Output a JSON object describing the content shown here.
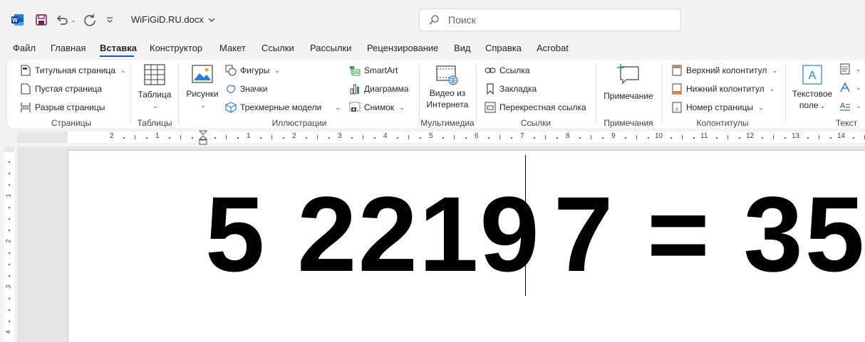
{
  "titlebar": {
    "doc_title": "WiFiGiD.RU.docx",
    "search_placeholder": "Поиск"
  },
  "tabs": [
    "Файл",
    "Главная",
    "Вставка",
    "Конструктор",
    "Макет",
    "Ссылки",
    "Рассылки",
    "Рецензирование",
    "Вид",
    "Справка",
    "Acrobat"
  ],
  "active_tab": "Вставка",
  "ribbon": {
    "pages": {
      "label": "Страницы",
      "cover": "Титульная страница",
      "blank": "Пустая страница",
      "break": "Разрыв страницы"
    },
    "tables": {
      "label": "Таблицы",
      "table": "Таблица"
    },
    "illustrations": {
      "label": "Иллюстрации",
      "pictures": "Рисунки",
      "shapes": "Фигуры",
      "icons": "Значки",
      "models3d": "Трехмерные модели",
      "smartart": "SmartArt",
      "chart": "Диаграмма",
      "screenshot": "Снимок"
    },
    "media": {
      "label": "Мультимедиа",
      "video_line1": "Видео из",
      "video_line2": "Интернета"
    },
    "links": {
      "label": "Ссылки",
      "link": "Ссылка",
      "bookmark": "Закладка",
      "crossref": "Перекрестная ссылка"
    },
    "comments": {
      "label": "Примечания",
      "comment": "Примечание"
    },
    "headerfooter": {
      "label": "Колонтитулы",
      "header": "Верхний колонтитул",
      "footer": "Нижний колонтитул",
      "pagenum": "Номер страницы"
    },
    "text": {
      "label": "Текст",
      "textbox_line1": "Текстовое",
      "textbox_line2": "поле"
    }
  },
  "ruler": {
    "h_numbers": [
      "2",
      "1",
      "1",
      "2",
      "3",
      "4",
      "5",
      "6",
      "7",
      "8",
      "9",
      "10",
      "11",
      "12",
      "13",
      "14"
    ],
    "v_numbers": [
      "1",
      "2",
      "3",
      "4"
    ]
  },
  "document": {
    "left_text": "5 2219",
    "right_text": "7 = 35"
  },
  "colors": {
    "accent": "#185abd",
    "word_blue": "#185abd",
    "text": "#242424"
  }
}
